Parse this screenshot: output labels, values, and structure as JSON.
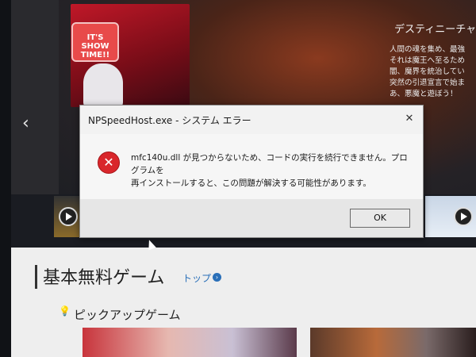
{
  "hero": {
    "title": "デスティニーチャ",
    "poster_logo": "IT'S SHOW TIME!!",
    "description_lines": [
      "人間の魂を集め、最強",
      "それは魔王へ至るため",
      "闇、魔界を統治してい",
      "突然の引退宣言で始ま",
      "あ、悪魔と遊ぼう！"
    ],
    "nav_prev": "‹"
  },
  "thumbnails": [
    {
      "name": "thumb-left",
      "icon": "play-icon"
    },
    {
      "name": "thumb-right",
      "icon": "play-icon"
    }
  ],
  "dialog": {
    "title": "NPSpeedHost.exe - システム エラー",
    "close_label": "✕",
    "icon": "error-icon",
    "icon_glyph": "✕",
    "message_lines": [
      "mfc140u.dll が見つからないため、コードの実行を続行できません。プログラムを",
      "再インストールすると、この問題が解決する可能性があります。"
    ],
    "ok_label": "OK"
  },
  "section": {
    "title": "基本無料ゲーム",
    "link_label": "トップ",
    "link_icon": "›",
    "subtitle": "ピックアップゲーム",
    "subtitle_icon": "💡"
  },
  "colors": {
    "error_red": "#d9262b",
    "link_blue": "#2a6fb8",
    "dialog_bg": "#f2f2f2"
  }
}
